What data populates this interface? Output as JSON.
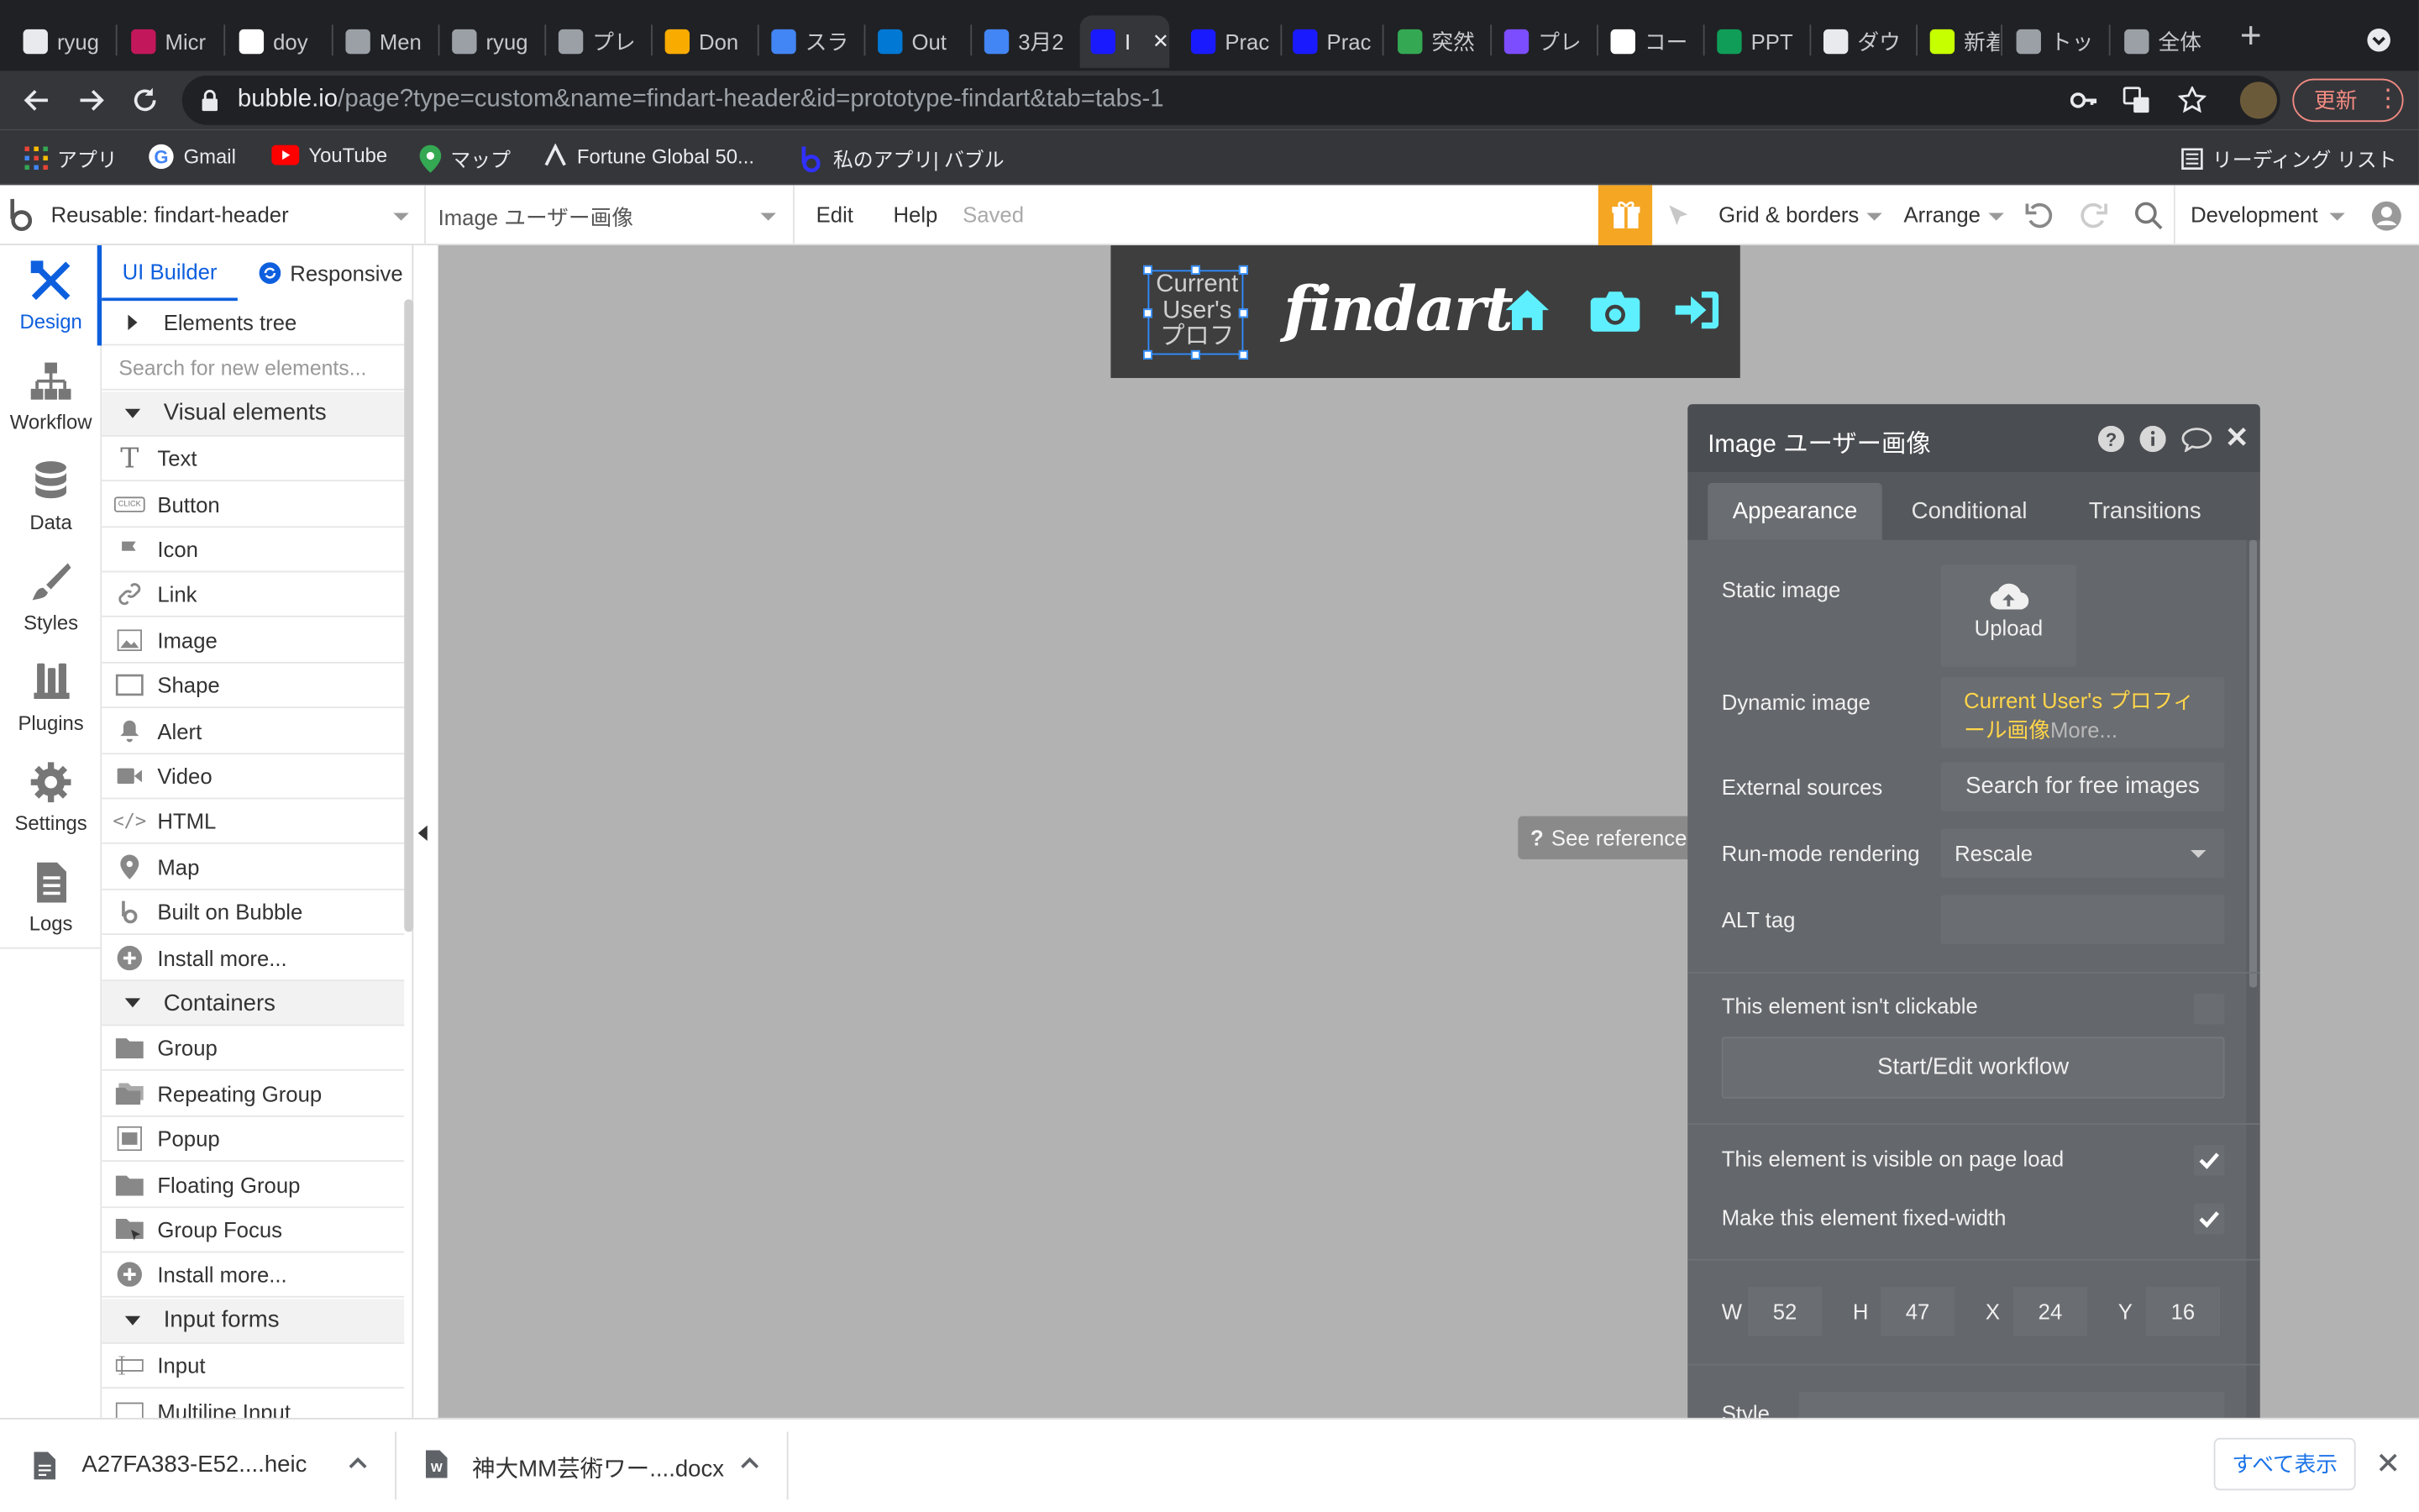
{
  "browser": {
    "tabs": [
      {
        "label": "ryug",
        "color": "#e8eaed"
      },
      {
        "label": "Micr",
        "color": "#c2185b"
      },
      {
        "label": "doy",
        "color": "#ffffff"
      },
      {
        "label": "Men",
        "color": "#9aa0a6"
      },
      {
        "label": "ryug",
        "color": "#9aa0a6"
      },
      {
        "label": "プレ",
        "color": "#9aa0a6"
      },
      {
        "label": "Don",
        "color": "#f9ab00"
      },
      {
        "label": "スラ",
        "color": "#4285f4"
      },
      {
        "label": "Out",
        "color": "#0078d4"
      },
      {
        "label": "3月2",
        "color": "#4285f4"
      },
      {
        "label": "I",
        "color": "#1a1aff"
      },
      {
        "label": "Prac",
        "color": "#1a1aff"
      },
      {
        "label": "Prac",
        "color": "#1a1aff"
      },
      {
        "label": "突然",
        "color": "#34a853"
      },
      {
        "label": "プレ",
        "color": "#7c4dff"
      },
      {
        "label": "コー",
        "color": "#ffffff"
      },
      {
        "label": "PPT",
        "color": "#0f9d58"
      },
      {
        "label": "ダウ",
        "color": "#e8eaed"
      },
      {
        "label": "新着",
        "color": "#c6ff00"
      },
      {
        "label": "トッ",
        "color": "#9aa0a6"
      },
      {
        "label": "全体",
        "color": "#9aa0a6"
      }
    ],
    "url_host": "bubble.io",
    "url_path": "/page?type=custom&name=findart-header&id=prototype-findart&tab=tabs-1",
    "update_label": "更新",
    "bookmarks": [
      "アプリ",
      "Gmail",
      "YouTube",
      "マップ",
      "Fortune Global 50...",
      "私のアプリ| バブル"
    ],
    "reading_list": "リーディング リスト"
  },
  "editor": {
    "reusable": "Reusable: findart-header",
    "element_select": "Image ユーザー画像",
    "menu_edit": "Edit",
    "menu_help": "Help",
    "saved": "Saved",
    "grid": "Grid & borders",
    "arrange": "Arrange",
    "env": "Development"
  },
  "rail": [
    "Design",
    "Workflow",
    "Data",
    "Styles",
    "Plugins",
    "Settings",
    "Logs"
  ],
  "palette": {
    "tab_builder": "UI Builder",
    "tab_responsive": "Responsive",
    "elements_tree": "Elements tree",
    "search_placeholder": "Search for new elements...",
    "visual_header": "Visual elements",
    "visual": [
      "Text",
      "Button",
      "Icon",
      "Link",
      "Image",
      "Shape",
      "Alert",
      "Video",
      "HTML",
      "Map",
      "Built on Bubble",
      "Install more..."
    ],
    "containers_header": "Containers",
    "containers": [
      "Group",
      "Repeating Group",
      "Popup",
      "Floating Group",
      "Group Focus",
      "Install more..."
    ],
    "inputs_header": "Input forms",
    "inputs": [
      "Input",
      "Multiline Input"
    ]
  },
  "canvas": {
    "placeholder": "Current User's プロフ",
    "logo": "findart",
    "icon_color": "#5ff0ff",
    "see_reference": "See reference →"
  },
  "panel": {
    "title": "Image ユーザー画像",
    "tabs": [
      "Appearance",
      "Conditional",
      "Transitions"
    ],
    "static_image": "Static image",
    "upload": "Upload",
    "dynamic_image": "Dynamic image",
    "dynamic_value": "Current User's プロフィール画像",
    "more": "More...",
    "external_sources": "External sources",
    "search_free": "Search for free images",
    "run_mode": "Run-mode rendering",
    "run_mode_value": "Rescale",
    "alt_tag": "ALT tag",
    "not_clickable": "This element isn't clickable",
    "start_workflow": "Start/Edit workflow",
    "visible_on_load": "This element is visible on page load",
    "fixed_width": "Make this element fixed-width",
    "w_label": "W",
    "w": "52",
    "h_label": "H",
    "h": "47",
    "x_label": "X",
    "x": "24",
    "y_label": "Y",
    "y": "16",
    "style": "Style"
  },
  "downloads": {
    "files": [
      "A27FA383-E52....heic",
      "神大MM芸術ワー....docx"
    ],
    "show_all": "すべて表示"
  }
}
